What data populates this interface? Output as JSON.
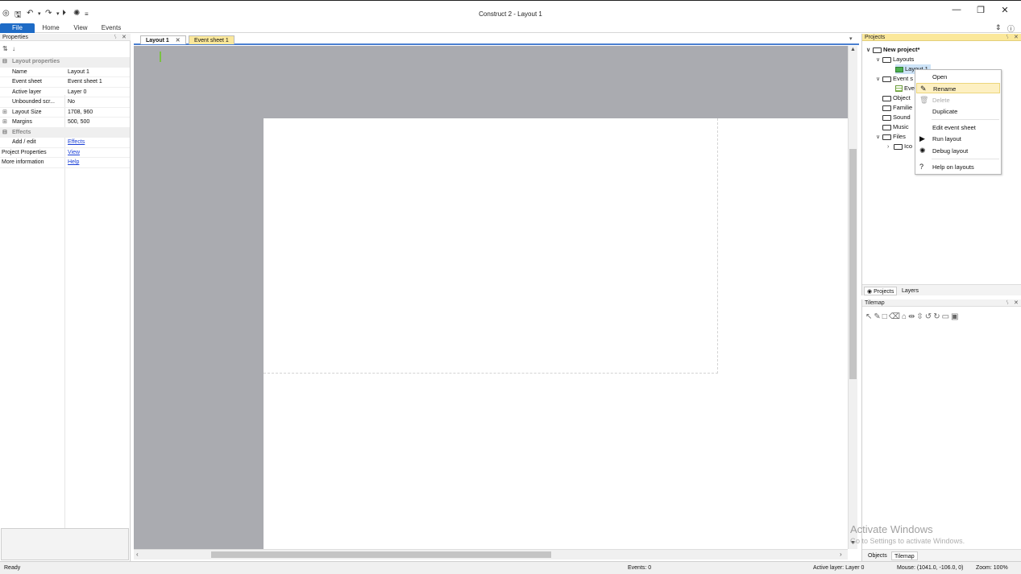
{
  "window": {
    "title": "Construct 2 - Layout 1",
    "minimize": "—",
    "restore": "❐",
    "close": "✕"
  },
  "ribbon": {
    "tabs": [
      "File",
      "Home",
      "View",
      "Events"
    ]
  },
  "properties": {
    "title": "Properties",
    "category_layout": "Layout properties",
    "rows": [
      {
        "key": "Name",
        "value": "Layout 1"
      },
      {
        "key": "Event sheet",
        "value": "Event sheet 1"
      },
      {
        "key": "Active layer",
        "value": "Layer 0"
      },
      {
        "key": "Unbounded scr...",
        "value": "No"
      },
      {
        "key": "Layout Size",
        "value": "1708, 960"
      },
      {
        "key": "Margins",
        "value": "500, 500"
      }
    ],
    "category_effects": "Effects",
    "effects_row": {
      "key": "Add / edit",
      "value": "Effects"
    },
    "project_properties": {
      "key": "Project Properties",
      "value": "View"
    },
    "more_information": {
      "key": "More information",
      "value": "Help"
    }
  },
  "editor": {
    "tabs": [
      "Layout 1",
      "Event sheet 1"
    ]
  },
  "projects": {
    "title": "Projects",
    "tree": {
      "root": "New project*",
      "layouts": "Layouts",
      "layout1": "Layout 1",
      "event_sheets": "Event s",
      "event_sheet1": "Eve",
      "objects": "Object",
      "families": "Familie",
      "sounds": "Sound",
      "music": "Music",
      "files": "Files",
      "icons": "Ico"
    },
    "bottom_tabs": [
      "Projects",
      "Layers"
    ]
  },
  "context_menu": {
    "items": [
      {
        "label": "Open",
        "icon": ""
      },
      {
        "label": "Rename",
        "icon": "pencil-icon"
      },
      {
        "label": "Delete",
        "icon": "trash-icon"
      },
      {
        "label": "Duplicate",
        "icon": ""
      },
      {
        "label": "Edit event sheet",
        "icon": ""
      },
      {
        "label": "Run layout",
        "icon": "play-icon"
      },
      {
        "label": "Debug layout",
        "icon": "bug-icon"
      },
      {
        "label": "Help on layouts",
        "icon": "help-icon"
      }
    ]
  },
  "tilemap": {
    "title": "Tilemap",
    "bottom_tabs": [
      "Objects",
      "Tilemap"
    ]
  },
  "status": {
    "ready": "Ready",
    "events": "Events: 0",
    "active_layer": "Active layer: Layer 0",
    "mouse": "Mouse: (1041.0, -106.0, 0)",
    "zoom": "Zoom: 100%"
  },
  "watermark": {
    "line1": "Activate Windows",
    "line2": "Go to Settings to activate Windows."
  },
  "colors": {
    "accent": "#1e6bc6",
    "projects_header": "#fbe89b",
    "layout_background": "#aaabb0"
  }
}
